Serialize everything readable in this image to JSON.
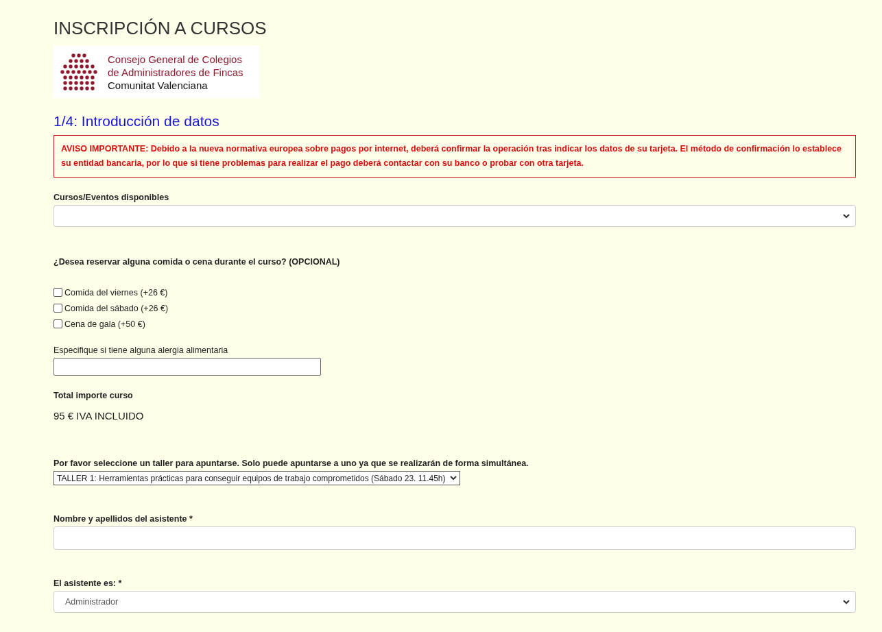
{
  "page_title": "INSCRIPCIÓN A CURSOS",
  "logo": {
    "lines": [
      "Consejo General de Colegios",
      "de Administradores de Fincas",
      "Comunitat Valenciana"
    ]
  },
  "step_title": "1/4: Introducción de datos",
  "notice": "AVISO IMPORTANTE: Debido a la nueva normativa europea sobre pagos por internet, deberá confirmar la operación tras indicar los datos de su tarjeta. El método de confirmación lo establece su entidad bancaria, por lo que si tiene problemas para realizar el pago deberá contactar con su banco o probar con otra tarjeta.",
  "courses_field": {
    "label": "Cursos/Eventos disponibles"
  },
  "meals": {
    "question": "¿Desea reservar alguna comida o cena durante el curso? (OPCIONAL)",
    "options": [
      {
        "label": "Comida del viernes (+26 €)",
        "checked": false
      },
      {
        "label": "Comida del sábado (+26 €)",
        "checked": false
      },
      {
        "label": "Cena de gala (+50 €)",
        "checked": false
      }
    ]
  },
  "allergy_field": {
    "label": "Especifique si tiene alguna alergia alimentaria"
  },
  "total": {
    "label": "Total importe curso",
    "value": "95 € IVA INCLUIDO"
  },
  "workshop_field": {
    "label": "Por favor seleccione un taller para apuntarse. Solo puede apuntarse a uno ya que se realizarán de forma simultánea.",
    "value": "TALLER 1: Herramientas prácticas para conseguir equipos de trabajo comprometidos (Sábado 23. 11.45h)"
  },
  "name_field": {
    "label": "Nombre y apellidos del asistente *"
  },
  "attendee_type_field": {
    "label": "El asistente es: *",
    "value": "Administrador"
  }
}
